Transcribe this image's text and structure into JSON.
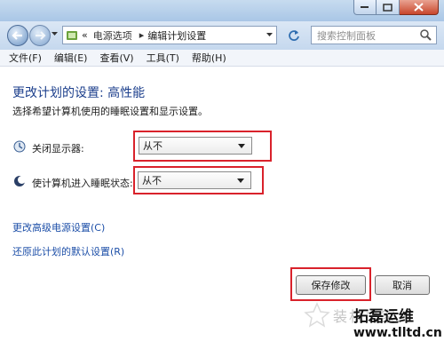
{
  "window": {
    "controls": {
      "minimize": "minimize",
      "maximize": "maximize",
      "close": "close"
    }
  },
  "address_bar": {
    "prefix": "«",
    "breadcrumb": [
      "电源选项",
      "编辑计划设置"
    ],
    "breadcrumb_separator": "▸",
    "search_placeholder": "搜索控制面板"
  },
  "menu": {
    "items": [
      "文件(F)",
      "编辑(E)",
      "查看(V)",
      "工具(T)",
      "帮助(H)"
    ]
  },
  "main": {
    "title": "更改计划的设置: 高性能",
    "description": "选择希望计算机使用的睡眠设置和显示设置。",
    "settings": [
      {
        "label": "关闭显示器:",
        "value": "从不",
        "icon": "monitor-icon"
      },
      {
        "label": "使计算机进入睡眠状态:",
        "value": "从不",
        "icon": "moon-icon"
      }
    ],
    "links": [
      "更改高级电源设置(C)",
      "还原此计划的默认设置(R)"
    ],
    "buttons": {
      "save": "保存修改",
      "cancel": "取消"
    }
  },
  "watermark": {
    "overlay_text": "装机之家",
    "brand": "拓磊运维",
    "url": "www.tlltd.cn"
  },
  "colors": {
    "highlight": "#d9222b",
    "title": "#1c3f8c",
    "link": "#1d4fa8"
  }
}
